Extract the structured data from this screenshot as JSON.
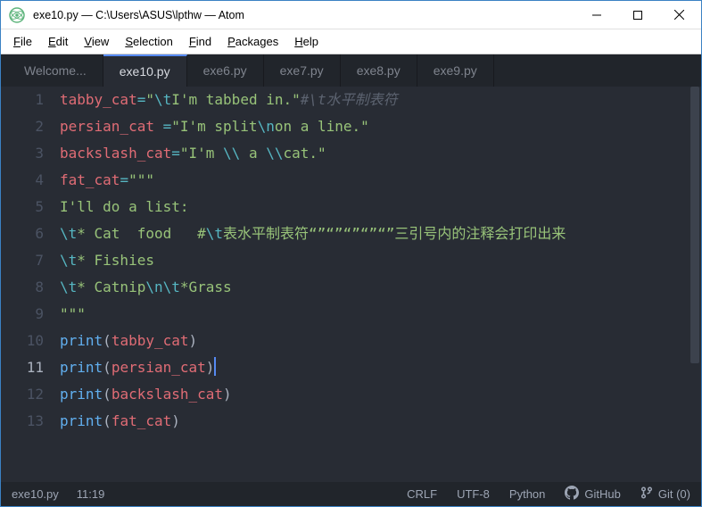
{
  "window": {
    "title": "exe10.py — C:\\Users\\ASUS\\lpthw — Atom"
  },
  "menu": {
    "file": "File",
    "edit": "Edit",
    "view": "View",
    "selection": "Selection",
    "find": "Find",
    "packages": "Packages",
    "help": "Help"
  },
  "tabs": [
    {
      "label": "Welcome...",
      "active": false
    },
    {
      "label": "exe10.py",
      "active": true
    },
    {
      "label": "exe6.py",
      "active": false
    },
    {
      "label": "exe7.py",
      "active": false
    },
    {
      "label": "exe8.py",
      "active": false
    },
    {
      "label": "exe9.py",
      "active": false
    }
  ],
  "code": {
    "lines": [
      {
        "n": 1,
        "segs": [
          {
            "t": "tabby_cat",
            "c": "tok-var"
          },
          {
            "t": "=",
            "c": "tok-op"
          },
          {
            "t": "\"",
            "c": "tok-str"
          },
          {
            "t": "\\t",
            "c": "tok-esc"
          },
          {
            "t": "I'm tabbed in.\"",
            "c": "tok-str"
          },
          {
            "t": "#",
            "c": "tok-comment"
          },
          {
            "t": "\\t",
            "c": "tok-comment"
          },
          {
            "t": "水平制表符",
            "c": "tok-comment"
          }
        ]
      },
      {
        "n": 2,
        "segs": [
          {
            "t": "persian_cat ",
            "c": "tok-var"
          },
          {
            "t": "=",
            "c": "tok-op"
          },
          {
            "t": "\"I'm split",
            "c": "tok-str"
          },
          {
            "t": "\\n",
            "c": "tok-esc"
          },
          {
            "t": "on a line.\"",
            "c": "tok-str"
          }
        ]
      },
      {
        "n": 3,
        "segs": [
          {
            "t": "backslash_cat",
            "c": "tok-var"
          },
          {
            "t": "=",
            "c": "tok-op"
          },
          {
            "t": "\"I'm ",
            "c": "tok-str"
          },
          {
            "t": "\\\\",
            "c": "tok-esc"
          },
          {
            "t": " a ",
            "c": "tok-str"
          },
          {
            "t": "\\\\",
            "c": "tok-esc"
          },
          {
            "t": "cat.\"",
            "c": "tok-str"
          }
        ]
      },
      {
        "n": 4,
        "segs": [
          {
            "t": "fat_cat",
            "c": "tok-var"
          },
          {
            "t": "=",
            "c": "tok-op"
          },
          {
            "t": "\"\"\"",
            "c": "tok-str"
          }
        ]
      },
      {
        "n": 5,
        "segs": [
          {
            "t": "I'll do a list:",
            "c": "tok-str"
          }
        ]
      },
      {
        "n": 6,
        "segs": [
          {
            "t": "\\t",
            "c": "tok-esc"
          },
          {
            "t": "* Cat  food   #",
            "c": "tok-str"
          },
          {
            "t": "\\t",
            "c": "tok-esc"
          },
          {
            "t": "表水平制表符“”“”“”“”“”三引号内的注释会打印出来",
            "c": "tok-str"
          }
        ]
      },
      {
        "n": 7,
        "segs": [
          {
            "t": "\\t",
            "c": "tok-esc"
          },
          {
            "t": "* Fishies",
            "c": "tok-str"
          }
        ]
      },
      {
        "n": 8,
        "segs": [
          {
            "t": "\\t",
            "c": "tok-esc"
          },
          {
            "t": "* Catnip",
            "c": "tok-str"
          },
          {
            "t": "\\n\\t",
            "c": "tok-esc"
          },
          {
            "t": "*Grass",
            "c": "tok-str"
          }
        ]
      },
      {
        "n": 9,
        "segs": [
          {
            "t": "\"\"\"",
            "c": "tok-str"
          }
        ]
      },
      {
        "n": 10,
        "segs": [
          {
            "t": "print",
            "c": "tok-func"
          },
          {
            "t": "(",
            "c": "tok-punc"
          },
          {
            "t": "tabby_cat",
            "c": "tok-var"
          },
          {
            "t": ")",
            "c": "tok-punc"
          }
        ]
      },
      {
        "n": 11,
        "active": true,
        "cursor": true,
        "segs": [
          {
            "t": "print",
            "c": "tok-func"
          },
          {
            "t": "(",
            "c": "tok-punc"
          },
          {
            "t": "persian_cat",
            "c": "tok-var"
          },
          {
            "t": ")",
            "c": "tok-punc"
          }
        ]
      },
      {
        "n": 12,
        "segs": [
          {
            "t": "print",
            "c": "tok-func"
          },
          {
            "t": "(",
            "c": "tok-punc"
          },
          {
            "t": "backslash_cat",
            "c": "tok-var"
          },
          {
            "t": ")",
            "c": "tok-punc"
          }
        ]
      },
      {
        "n": 13,
        "segs": [
          {
            "t": "print",
            "c": "tok-func"
          },
          {
            "t": "(",
            "c": "tok-punc"
          },
          {
            "t": "fat_cat",
            "c": "tok-var"
          },
          {
            "t": ")",
            "c": "tok-punc"
          }
        ]
      }
    ]
  },
  "status": {
    "file": "exe10.py",
    "cursor": "11:19",
    "eol": "CRLF",
    "encoding": "UTF-8",
    "grammar": "Python",
    "github": "GitHub",
    "git": "Git (0)"
  }
}
